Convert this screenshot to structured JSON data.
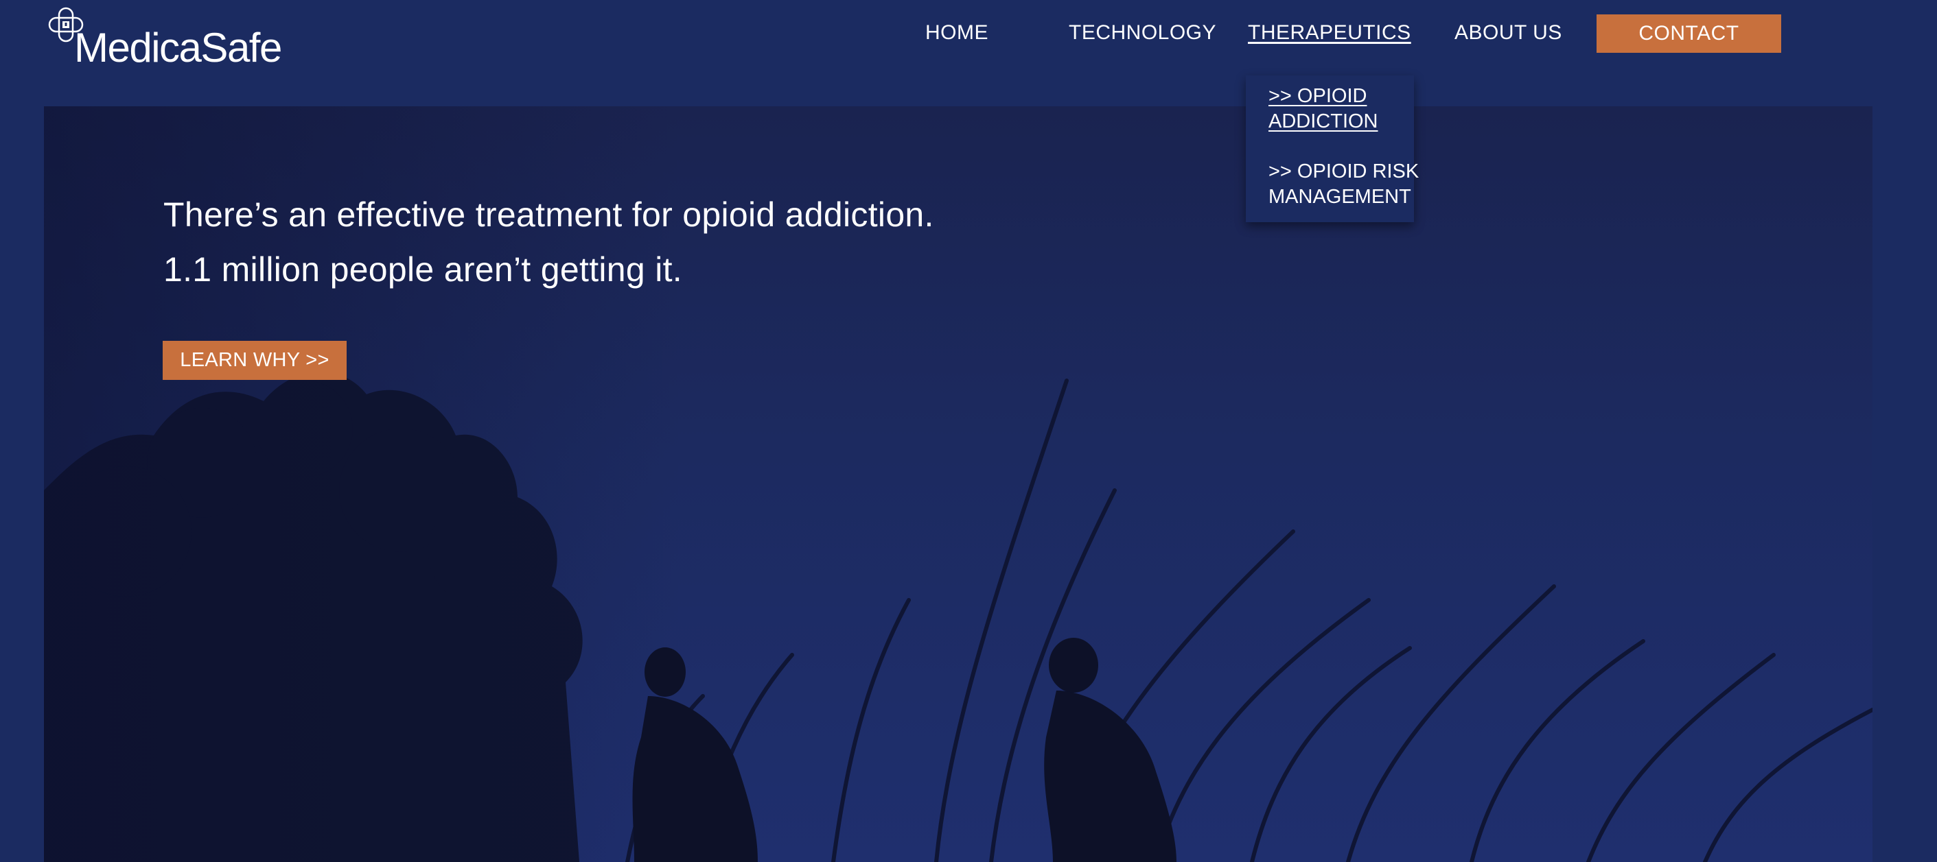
{
  "brand": {
    "name": "MedicaSafe"
  },
  "nav": {
    "items": [
      {
        "label": "HOME"
      },
      {
        "label": "TECHNOLOGY"
      },
      {
        "label": "THERAPEUTICS"
      },
      {
        "label": "ABOUT US"
      }
    ],
    "contact_label": "CONTACT"
  },
  "dropdown": {
    "items": [
      {
        "line1": ">> OPIOID",
        "line2": "ADDICTION"
      },
      {
        "line1": ">> OPIOID RISK",
        "line2": "MANAGEMENT"
      }
    ]
  },
  "hero": {
    "headline_line1": "There’s an effective treatment for opioid addiction.",
    "headline_line2": "1.1 million people aren’t getting it.",
    "cta_label": "LEARN WHY >>"
  },
  "colors": {
    "background": "#1b2b61",
    "accent": "#c8703d",
    "text": "#ffffff"
  },
  "icons": {
    "logo": "medical-cross-lock-icon"
  }
}
